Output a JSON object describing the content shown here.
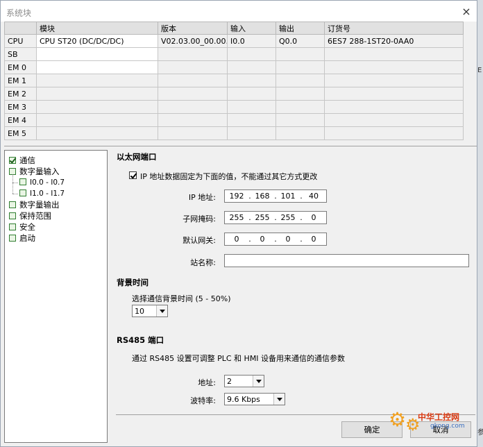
{
  "window": {
    "title": "系统块",
    "close_glyph": "×"
  },
  "module_table": {
    "headers": [
      "",
      "模块",
      "版本",
      "输入",
      "输出",
      "订货号"
    ],
    "rows": [
      {
        "slot": "CPU",
        "module": "CPU ST20 (DC/DC/DC)",
        "version": "V02.03.00_00.00...",
        "input": "I0.0",
        "output": "Q0.0",
        "order": "6ES7 288-1ST20-0AA0"
      },
      {
        "slot": "SB",
        "module": "",
        "version": "",
        "input": "",
        "output": "",
        "order": ""
      },
      {
        "slot": "EM 0",
        "module": "",
        "version": "",
        "input": "",
        "output": "",
        "order": ""
      },
      {
        "slot": "EM 1",
        "module": "",
        "version": "",
        "input": "",
        "output": "",
        "order": ""
      },
      {
        "slot": "EM 2",
        "module": "",
        "version": "",
        "input": "",
        "output": "",
        "order": ""
      },
      {
        "slot": "EM 3",
        "module": "",
        "version": "",
        "input": "",
        "output": "",
        "order": ""
      },
      {
        "slot": "EM 4",
        "module": "",
        "version": "",
        "input": "",
        "output": "",
        "order": ""
      },
      {
        "slot": "EM 5",
        "module": "",
        "version": "",
        "input": "",
        "output": "",
        "order": ""
      }
    ]
  },
  "tree": {
    "items": [
      {
        "label": "通信",
        "checked": true
      },
      {
        "label": "数字量输入",
        "checked": false
      },
      {
        "label": "I0.0 - I0.7",
        "checked": false
      },
      {
        "label": "I1.0 - I1.7",
        "checked": false
      },
      {
        "label": "数字量输出",
        "checked": false
      },
      {
        "label": "保持范围",
        "checked": false
      },
      {
        "label": "安全",
        "checked": false
      },
      {
        "label": "启动",
        "checked": false
      }
    ]
  },
  "ethernet": {
    "title": "以太网端口",
    "fixed_ip_label": "IP 地址数据固定为下面的值，不能通过其它方式更改",
    "fixed_ip_checked": true,
    "ip_label": "IP 地址:",
    "ip": [
      "192",
      "168",
      "101",
      "40"
    ],
    "mask_label": "子网掩码:",
    "mask": [
      "255",
      "255",
      "255",
      "0"
    ],
    "gateway_label": "默认网关:",
    "gateway": [
      "0",
      "0",
      "0",
      "0"
    ],
    "station_label": "站名称:",
    "station_value": ""
  },
  "background": {
    "title": "背景时间",
    "desc": "选择通信背景时间 (5 - 50%)",
    "value": "10"
  },
  "rs485": {
    "title": "RS485 端口",
    "desc": "通过 RS485 设置可调整 PLC 和 HMI 设备用来通信的通信参数",
    "address_label": "地址:",
    "address_value": "2",
    "baud_label": "波特率:",
    "baud_value": "9.6 Kbps"
  },
  "buttons": {
    "ok": "确定",
    "cancel": "取消"
  },
  "watermark": {
    "brand": "中华工控网",
    "domain": "gkong.com"
  },
  "edge": {
    "text_top": "E",
    "text_bottom": "参"
  }
}
